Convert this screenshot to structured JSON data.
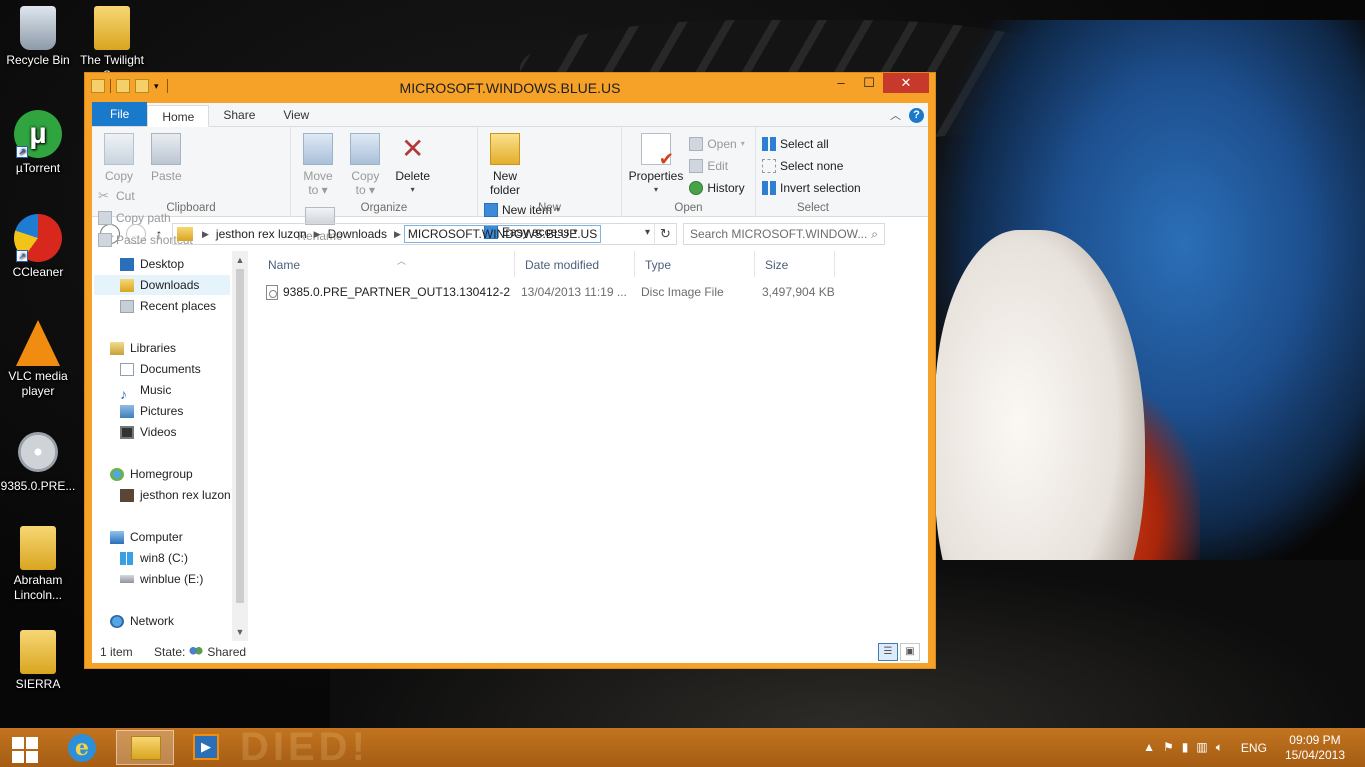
{
  "desktop": {
    "icons": [
      {
        "label": "Recycle Bin",
        "icon": "recycle-bin-icon"
      },
      {
        "label": "The Twilight S...",
        "icon": "folder-icon"
      },
      {
        "label": "µTorrent",
        "icon": "utorrent-icon"
      },
      {
        "label": "CCleaner",
        "icon": "ccleaner-icon"
      },
      {
        "label": "VLC media player",
        "icon": "vlc-icon"
      },
      {
        "label": "9385.0.PRE...",
        "icon": "disc-image-icon"
      },
      {
        "label": "Abraham Lincoln...",
        "icon": "folder-icon"
      },
      {
        "label": "SIERRA",
        "icon": "folder-icon"
      }
    ]
  },
  "window": {
    "title": "MICROSOFT.WINDOWS.BLUE.US",
    "controls": {
      "minimize": "–",
      "maximize": "☐",
      "close": "✕"
    }
  },
  "ribbon": {
    "tabs": [
      "File",
      "Home",
      "Share",
      "View"
    ],
    "active_tab": "Home",
    "help": "?",
    "clipboard": {
      "label": "Clipboard",
      "copy": "Copy",
      "paste": "Paste",
      "cut": "Cut",
      "copy_path": "Copy path",
      "paste_shortcut": "Paste shortcut"
    },
    "organize": {
      "label": "Organize",
      "move_to_1": "Move",
      "move_to_2": "to ▾",
      "copy_to_1": "Copy",
      "copy_to_2": "to ▾",
      "delete": "Delete",
      "delete_caret": "▾",
      "rename": "Rename"
    },
    "new": {
      "label": "New",
      "new_folder_1": "New",
      "new_folder_2": "folder",
      "new_item": "New item",
      "easy_access": "Easy access"
    },
    "open": {
      "label": "Open",
      "properties": "Properties",
      "properties_caret": "▾",
      "open": "Open",
      "edit": "Edit",
      "history": "History"
    },
    "select": {
      "label": "Select",
      "select_all": "Select all",
      "select_none": "Select none",
      "invert_selection": "Invert selection"
    }
  },
  "address": {
    "crumbs": [
      "jesthon rex luzon",
      "Downloads",
      "MICROSOFT.WINDOWS.BLUE.US"
    ],
    "search_placeholder": "Search MICROSOFT.WINDOW..."
  },
  "nav": {
    "items": [
      {
        "label": "Desktop"
      },
      {
        "label": "Downloads"
      },
      {
        "label": "Recent places"
      },
      {
        "label": "Libraries"
      },
      {
        "label": "Documents"
      },
      {
        "label": "Music"
      },
      {
        "label": "Pictures"
      },
      {
        "label": "Videos"
      },
      {
        "label": "Homegroup"
      },
      {
        "label": "jesthon rex luzon"
      },
      {
        "label": "Computer"
      },
      {
        "label": "win8 (C:)"
      },
      {
        "label": "winblue (E:)"
      },
      {
        "label": "Network"
      }
    ],
    "selected": "Downloads"
  },
  "filelist": {
    "columns": [
      "Name",
      "Date modified",
      "Type",
      "Size"
    ],
    "rows": [
      {
        "name": "9385.0.PRE_PARTNER_OUT13.130412-210...",
        "date": "13/04/2013 11:19 ...",
        "type": "Disc Image File",
        "size": "3,497,904 KB"
      }
    ]
  },
  "status": {
    "count": "1 item",
    "state_label": "State:",
    "state_value": "Shared"
  },
  "taskbar": {
    "watermark": "DIED!",
    "language": "ENG",
    "time": "09:09 PM",
    "date": "15/04/2013"
  },
  "colors": {
    "window_frame": "#f6a229",
    "close_button": "#c7392b",
    "file_tab": "#1979ca",
    "taskbar": "#b3681a"
  }
}
